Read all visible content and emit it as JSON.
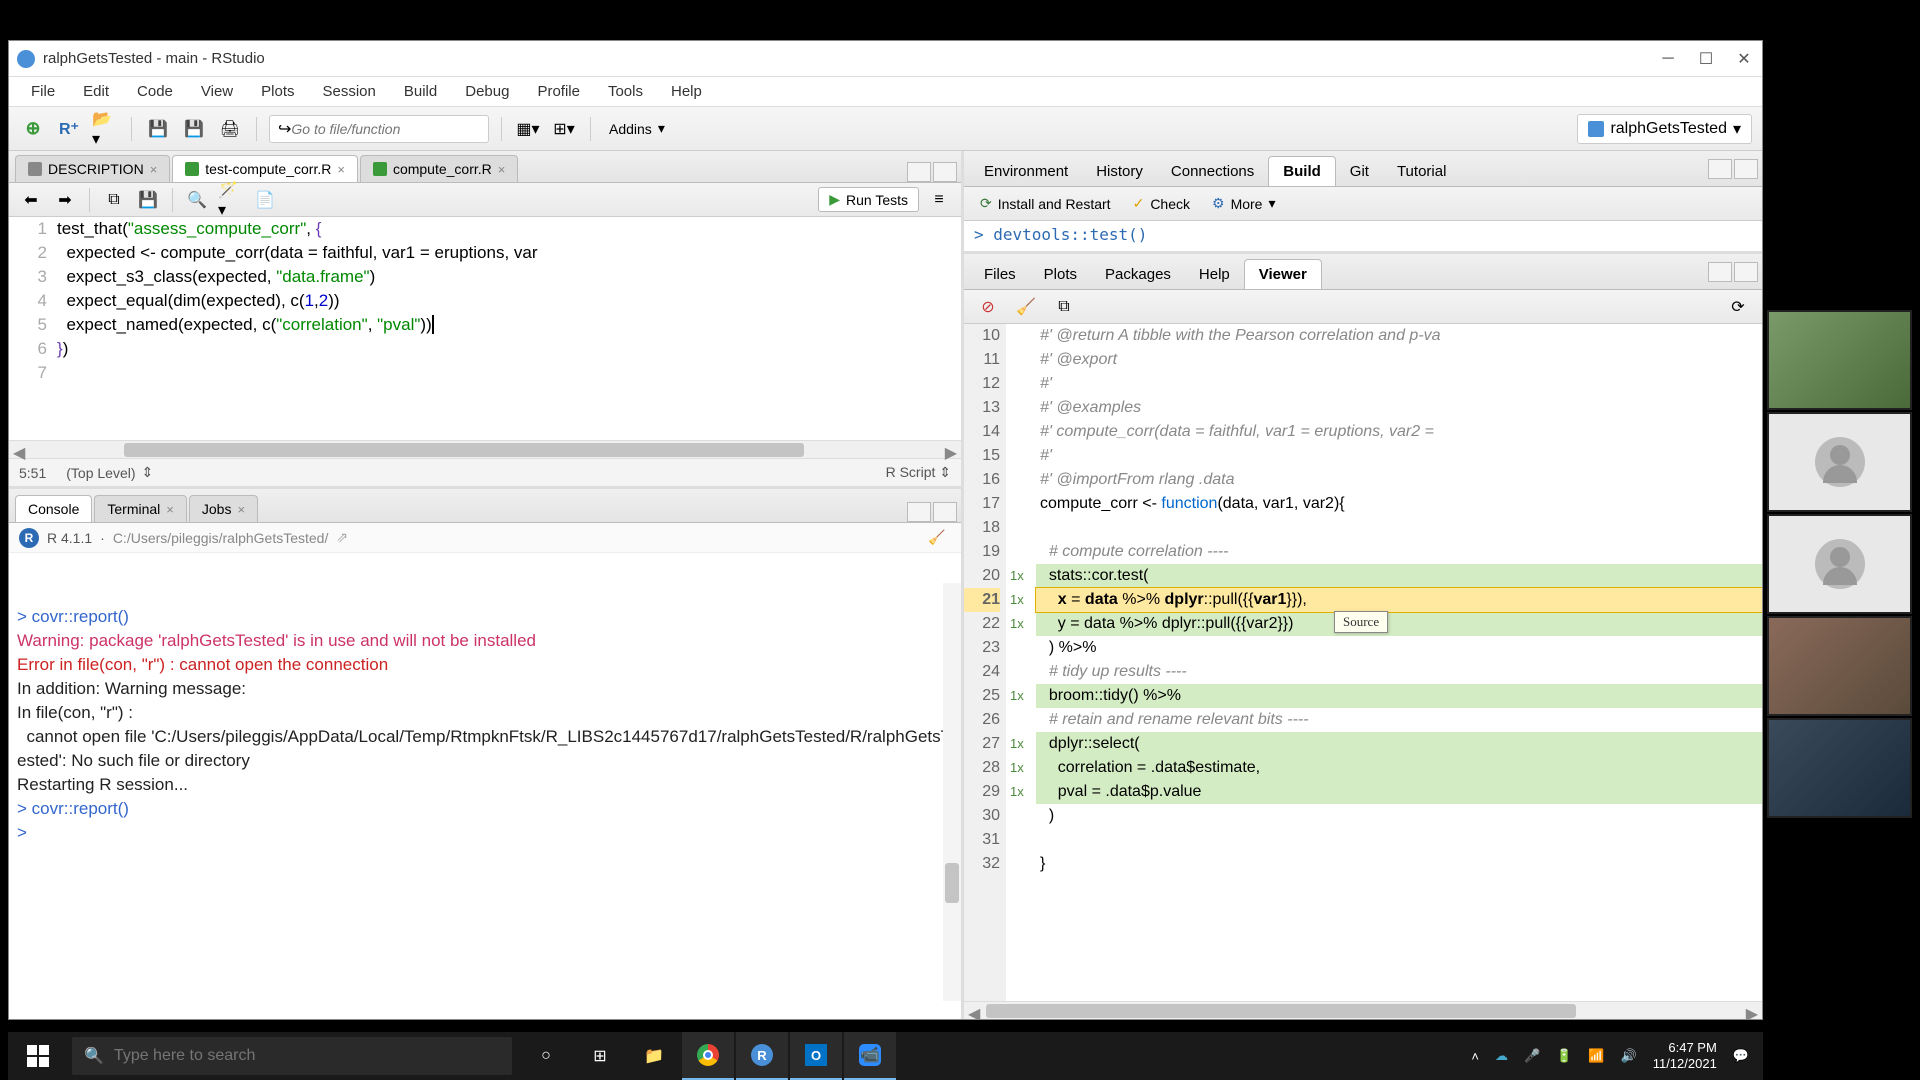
{
  "titlebar": {
    "text": "ralphGetsTested - main - RStudio"
  },
  "menubar": [
    "File",
    "Edit",
    "Code",
    "View",
    "Plots",
    "Session",
    "Build",
    "Debug",
    "Profile",
    "Tools",
    "Help"
  ],
  "toolbar": {
    "goto_placeholder": "Go to file/function",
    "addins": "Addins",
    "project": "ralphGetsTested"
  },
  "source": {
    "tabs": [
      {
        "label": "DESCRIPTION",
        "icon": "#888"
      },
      {
        "label": "test-compute_corr.R",
        "icon": "#3a9a3a",
        "active": true
      },
      {
        "label": "compute_corr.R",
        "icon": "#3a9a3a"
      }
    ],
    "run_tests": "Run Tests",
    "lines": [
      {
        "n": 1,
        "html": "test_that(<span class='kw-str'>\"assess_compute_corr\"</span>, <span class='kw-paren'>{</span>"
      },
      {
        "n": 2,
        "html": "  expected &lt;- compute_corr(data = faithful, var1 = eruptions, var"
      },
      {
        "n": 3,
        "html": "  expect_s3_class(expected, <span class='kw-str'>\"data.frame\"</span>)"
      },
      {
        "n": 4,
        "html": "  expect_equal(dim(expected), c(<span class='kw-num'>1</span>,<span class='kw-num'>2</span>))"
      },
      {
        "n": 5,
        "html": "  expect_named(expected, c(<span class='kw-str'>\"correlation\"</span>, <span class='kw-str'>\"pval\"</span>))<span style='border-left:2px solid #000'></span>"
      },
      {
        "n": 6,
        "html": "<span class='kw-paren'>}</span>)"
      },
      {
        "n": 7,
        "html": ""
      }
    ],
    "cursor": "5:51",
    "scope": "(Top Level)",
    "mode": "R Script"
  },
  "console": {
    "tabs": [
      {
        "label": "Console",
        "active": true
      },
      {
        "label": "Terminal"
      },
      {
        "label": "Jobs"
      }
    ],
    "version": "R 4.1.1",
    "wd": "C:/Users/pileggis/ralphGetsTested/",
    "lines": [
      {
        "cls": "c-prompt",
        "text": "> covr::report()"
      },
      {
        "cls": "c-warn",
        "text": "Warning: package 'ralphGetsTested' is in use and will not be installed"
      },
      {
        "cls": "c-err",
        "text": "Error in file(con, \"r\") : cannot open the connection"
      },
      {
        "cls": "c-text",
        "text": "In addition: Warning message:"
      },
      {
        "cls": "c-text",
        "text": "In file(con, \"r\") :"
      },
      {
        "cls": "c-text",
        "text": "  cannot open file 'C:/Users/pileggis/AppData/Local/Temp/RtmpknFtsk/R_LIBS2c1445767d17/ralphGetsTested/R/ralphGetsTested': No such file or directory"
      },
      {
        "cls": "c-text",
        "text": ""
      },
      {
        "cls": "c-text",
        "text": "Restarting R session..."
      },
      {
        "cls": "c-text",
        "text": ""
      },
      {
        "cls": "c-prompt",
        "text": "> covr::report()"
      },
      {
        "cls": "c-prompt",
        "text": "> "
      }
    ]
  },
  "env": {
    "tabs": [
      "Environment",
      "History",
      "Connections",
      "Build",
      "Git",
      "Tutorial"
    ],
    "active": "Build",
    "toolbar": {
      "install": "Install and Restart",
      "check": "Check",
      "more": "More"
    },
    "peek": "> devtools::test()"
  },
  "viewer": {
    "tabs": [
      "Files",
      "Plots",
      "Packages",
      "Help",
      "Viewer"
    ],
    "active": "Viewer",
    "tooltip": "Source",
    "lines": [
      {
        "n": 10,
        "cov": "",
        "html": "<span class='kw-comment'>#' @return A tibble with the Pearson correlation and p-va</span>"
      },
      {
        "n": 11,
        "cov": "",
        "html": "<span class='kw-comment'>#' @export</span>"
      },
      {
        "n": 12,
        "cov": "",
        "html": "<span class='kw-comment'>#'</span>"
      },
      {
        "n": 13,
        "cov": "",
        "html": "<span class='kw-comment'>#' @examples</span>"
      },
      {
        "n": 14,
        "cov": "",
        "html": "<span class='kw-comment'>#' compute_corr(data = faithful, var1 = eruptions, var2 =</span>"
      },
      {
        "n": 15,
        "cov": "",
        "html": "<span class='kw-comment'>#'</span>"
      },
      {
        "n": 16,
        "cov": "",
        "html": "<span class='kw-comment'>#' @importFrom rlang .data</span>"
      },
      {
        "n": 17,
        "cov": "",
        "html": "compute_corr &lt;- <span style='color:#0066cc'>function</span>(data, var1, var2){"
      },
      {
        "n": 18,
        "cov": "",
        "html": ""
      },
      {
        "n": 19,
        "cov": "",
        "html": "  <span class='kw-comment'># compute correlation ----</span>"
      },
      {
        "n": 20,
        "cov": "1x",
        "hit": true,
        "html": "  stats::cor.test("
      },
      {
        "n": 21,
        "cov": "1x",
        "hit": true,
        "current": true,
        "html": "    <b>x</b> = <b>data</b> %&gt;% <b>dplyr</b>::pull({{<b>var1</b>}}),"
      },
      {
        "n": 22,
        "cov": "1x",
        "hit": true,
        "html": "    y = data %&gt;% dplyr::pull({{var2}})"
      },
      {
        "n": 23,
        "cov": "",
        "html": "  ) %&gt;%"
      },
      {
        "n": 24,
        "cov": "",
        "html": "  <span class='kw-comment'># tidy up results ----</span>"
      },
      {
        "n": 25,
        "cov": "1x",
        "hit": true,
        "html": "  broom::tidy() %&gt;%"
      },
      {
        "n": 26,
        "cov": "",
        "html": "  <span class='kw-comment'># retain and rename relevant bits ----</span>"
      },
      {
        "n": 27,
        "cov": "1x",
        "hit": true,
        "html": "  dplyr::select("
      },
      {
        "n": 28,
        "cov": "1x",
        "hit": true,
        "html": "    correlation = .data$estimate,"
      },
      {
        "n": 29,
        "cov": "1x",
        "hit": true,
        "html": "    pval = .data$p.value"
      },
      {
        "n": 30,
        "cov": "",
        "html": "  )"
      },
      {
        "n": 31,
        "cov": "",
        "html": ""
      },
      {
        "n": 32,
        "cov": "",
        "html": "}"
      }
    ]
  },
  "taskbar": {
    "search": "Type here to search",
    "time": "6:47 PM",
    "date": "11/12/2021"
  }
}
